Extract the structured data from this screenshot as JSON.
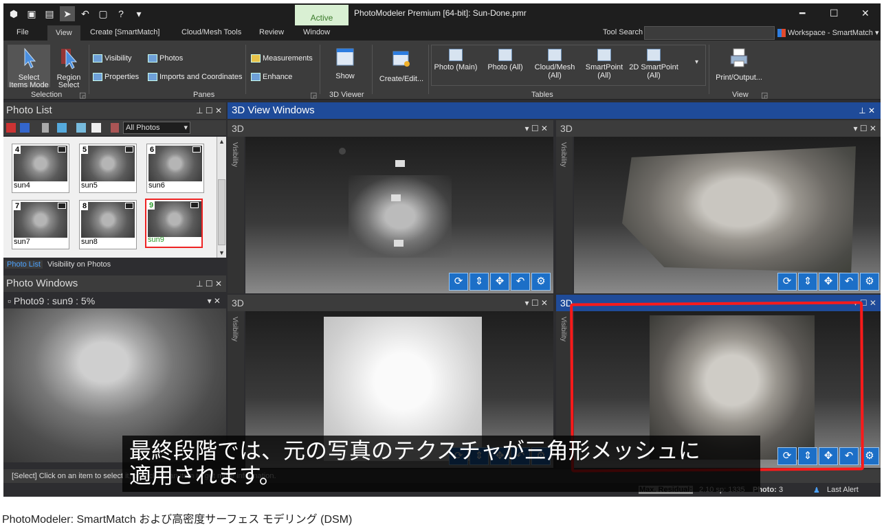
{
  "window": {
    "title": "PhotoModeler Premium [64-bit]: Sun-Done.pmr",
    "active_label": "Active",
    "minimize": "━",
    "maximize": "☐",
    "close": "✕"
  },
  "menu": {
    "items": [
      "File",
      "View",
      "Create [SmartMatch]",
      "Cloud/Mesh Tools",
      "Review",
      "Window"
    ],
    "tool_search_label": "Tool Search",
    "tool_search_value": "",
    "workspace": "Workspace - SmartMatch ▾"
  },
  "ribbon": {
    "select_items_mode": "Select\nItems Mode",
    "region_select": "Region\nSelect",
    "selection_group": "Selection",
    "visibility": "Visibility",
    "properties": "Properties",
    "photos": "Photos",
    "imports": "Imports and Coordinates",
    "measurements": "Measurements",
    "enhance": "Enhance",
    "panes_group": "Panes",
    "show": "Show",
    "viewer_group": "3D Viewer",
    "create_edit": "Create/Edit...",
    "tables": [
      "Photo (Main)",
      "Photo (All)",
      "Cloud/Mesh\n(All)",
      "SmartPoint\n(All)",
      "2D SmartPoint\n(All)"
    ],
    "tables_group": "Tables",
    "print_output": "Print/Output...",
    "view_group": "View"
  },
  "photo_list": {
    "title": "Photo List",
    "filter": "All Photos",
    "photos": [
      {
        "num": "4",
        "name": "sun4"
      },
      {
        "num": "5",
        "name": "sun5"
      },
      {
        "num": "6",
        "name": "sun6"
      },
      {
        "num": "7",
        "name": "sun7"
      },
      {
        "num": "8",
        "name": "sun8"
      },
      {
        "num": "9",
        "name": "sun9"
      }
    ],
    "tabs": [
      "Photo List",
      "Visibility on Photos"
    ]
  },
  "photo_windows": {
    "title": "Photo Windows",
    "sub": "Photo9 : sun9 : 5%"
  },
  "view3d": {
    "title": "3D View Windows",
    "window_label": "3D",
    "visibility": "Visibility"
  },
  "status": {
    "message": "[Select] Click on an item to select it, or click on an item to get more information.",
    "max_residual_label": "Max. Residual:",
    "max_residual_value": "2.10 sp: 1335",
    "photo_label": "Photo:",
    "photo_value": "3",
    "last_alert": "Last Alert"
  },
  "subtitle": {
    "line1": "最終段階では、元の写真のテクスチャが三角形メッシュに",
    "line2": "適用されます。"
  },
  "caption": "PhotoModeler: SmartMatch および高密度サーフェス モデリング (DSM)"
}
